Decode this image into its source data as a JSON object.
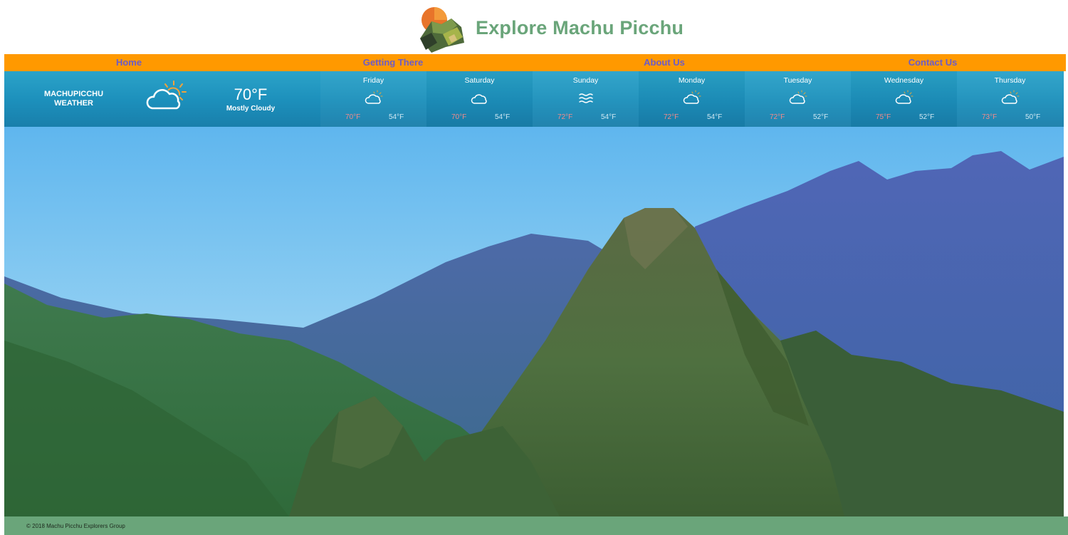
{
  "header": {
    "title": "Explore Machu Picchu",
    "title_color": "#6aa57a"
  },
  "nav": {
    "background": "#ff9900",
    "items": [
      {
        "label": "Home"
      },
      {
        "label": "Getting There"
      },
      {
        "label": "About Us"
      },
      {
        "label": "Contact Us"
      }
    ]
  },
  "weather": {
    "city_line1": "MACHUPICCHU",
    "city_line2": "WEATHER",
    "current_icon": "partly-cloudy-icon",
    "current_temp": "70°F",
    "current_desc": "Mostly Cloudy",
    "days": [
      {
        "name": "Friday",
        "icon": "partly-cloudy-icon",
        "high": "70°F",
        "low": "54°F"
      },
      {
        "name": "Saturday",
        "icon": "cloud-icon",
        "high": "70°F",
        "low": "54°F"
      },
      {
        "name": "Sunday",
        "icon": "fog-icon",
        "high": "72°F",
        "low": "54°F"
      },
      {
        "name": "Monday",
        "icon": "partly-cloudy-icon",
        "high": "72°F",
        "low": "54°F"
      },
      {
        "name": "Tuesday",
        "icon": "partly-cloudy-icon",
        "high": "72°F",
        "low": "52°F"
      },
      {
        "name": "Wednesday",
        "icon": "partly-cloudy-icon",
        "high": "75°F",
        "low": "52°F"
      },
      {
        "name": "Thursday",
        "icon": "partly-cloudy-icon",
        "high": "73°F",
        "low": "50°F"
      }
    ]
  },
  "footer": {
    "copyright": "© 2018 Machu Picchu Explorers Group",
    "background": "#6aa57a"
  }
}
